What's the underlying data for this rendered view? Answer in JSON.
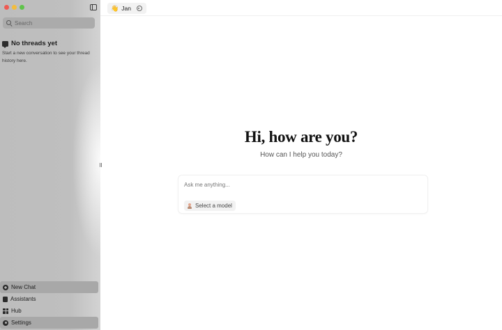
{
  "sidebar": {
    "search": {
      "placeholder": "Search"
    },
    "empty_state": {
      "title": "No threads yet",
      "description": "Start a new conversation to see your thread history here."
    },
    "nav": [
      {
        "label": "New Chat",
        "icon": "plus-circle-icon"
      },
      {
        "label": "Assistants",
        "icon": "clipboard-icon"
      },
      {
        "label": "Hub",
        "icon": "grid-icon"
      },
      {
        "label": "Settings",
        "icon": "gear-icon"
      }
    ]
  },
  "header": {
    "assistant_name": "Jan",
    "assistant_emoji": "👋"
  },
  "main": {
    "greeting": "Hi, how are you?",
    "subtitle": "How can I help you today?",
    "composer": {
      "placeholder": "Ask me anything...",
      "model_select_label": "Select a model"
    }
  },
  "colors": {
    "sidebar_bg": "#bdbdbd",
    "main_bg": "#ffffff",
    "close": "#ee5a52",
    "minimize": "#f3bc3c",
    "zoom": "#5fc34a"
  }
}
